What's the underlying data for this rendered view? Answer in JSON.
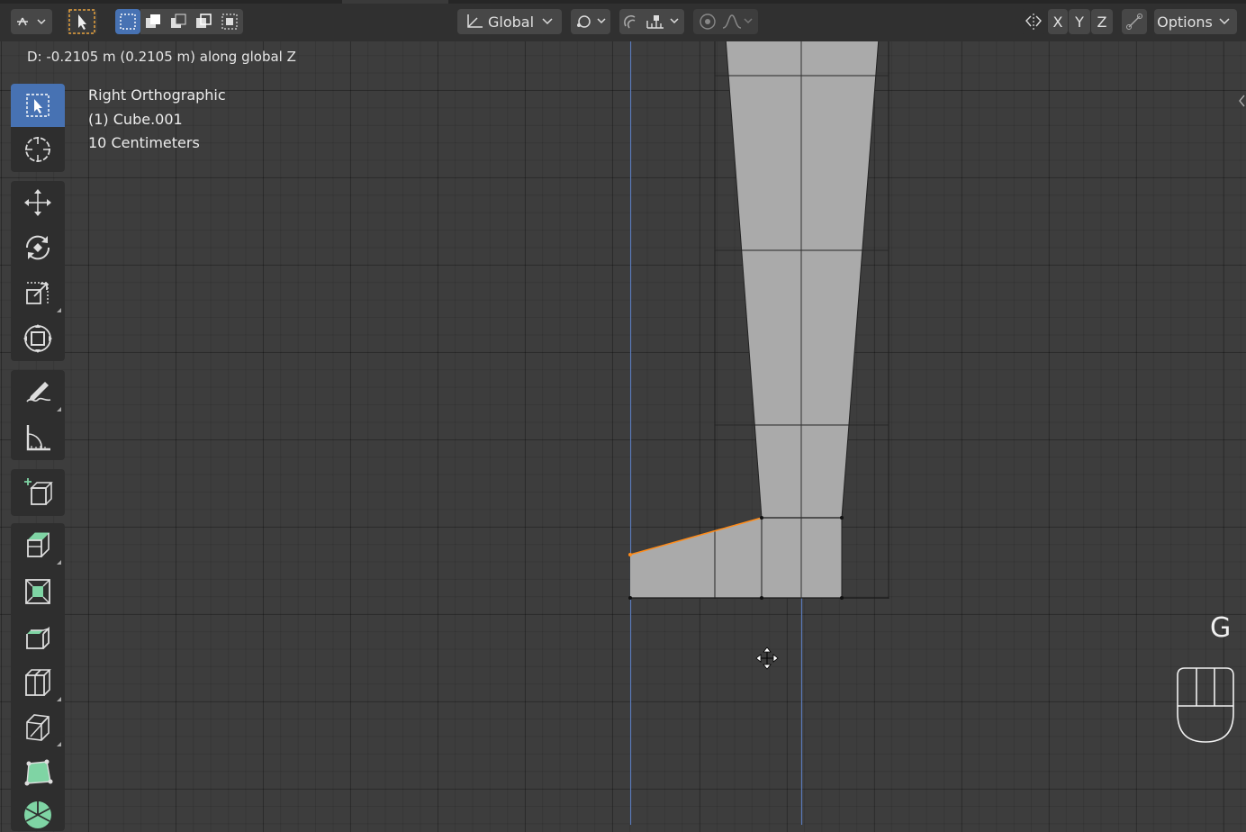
{
  "header": {
    "transform_orientation": "Global",
    "axis_x": "X",
    "axis_y": "Y",
    "axis_z": "Z",
    "options_label": "Options"
  },
  "status": {
    "transform_readout": "D: -0.2105 m (0.2105 m) along global Z"
  },
  "viewport_overlay": {
    "view_name": "Right Orthographic",
    "object_name": "(1) Cube.001",
    "grid_scale": "10 Centimeters"
  },
  "key_hint": "G",
  "toolbar": {
    "tools": [
      {
        "name": "select-box-tool",
        "icon": "select-box-icon",
        "active": true
      },
      {
        "name": "cursor-tool",
        "icon": "cursor-icon",
        "active": false
      },
      {
        "name": "move-tool",
        "icon": "move-icon",
        "active": false
      },
      {
        "name": "rotate-tool",
        "icon": "rotate-icon",
        "active": false
      },
      {
        "name": "scale-tool",
        "icon": "scale-icon",
        "active": false
      },
      {
        "name": "transform-tool",
        "icon": "transform-icon",
        "active": false
      },
      {
        "name": "annotate-tool",
        "icon": "annotate-icon",
        "active": false
      },
      {
        "name": "measure-tool",
        "icon": "measure-icon",
        "active": false
      },
      {
        "name": "add-cube-tool",
        "icon": "add-cube-icon",
        "active": false
      },
      {
        "name": "extrude-tool",
        "icon": "extrude-icon",
        "active": false
      },
      {
        "name": "inset-tool",
        "icon": "inset-icon",
        "active": false
      },
      {
        "name": "bevel-tool",
        "icon": "bevel-icon",
        "active": false
      },
      {
        "name": "loop-cut-tool",
        "icon": "loop-cut-icon",
        "active": false
      },
      {
        "name": "knife-tool",
        "icon": "knife-icon",
        "active": false
      },
      {
        "name": "poly-build-tool",
        "icon": "poly-build-icon",
        "active": false
      },
      {
        "name": "spin-tool",
        "icon": "spin-icon",
        "active": false
      }
    ]
  },
  "colors": {
    "viewport_bg": "#3d3d3d",
    "header_bg": "#303030",
    "accent": "#4772b3",
    "mesh_face": "#ababab",
    "selected_edge": "#ff8c1a",
    "axis_line": "#4f6ea8"
  }
}
